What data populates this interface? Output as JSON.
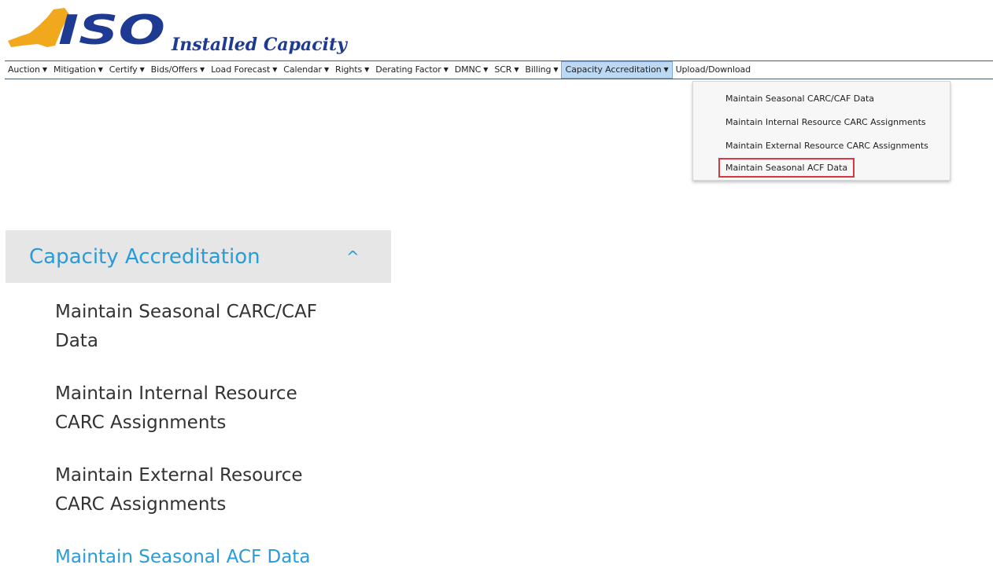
{
  "header": {
    "logo_text": "ISO",
    "app_title": "Installed Capacity"
  },
  "menu": {
    "items": [
      {
        "label": "Auction",
        "caret": "▼"
      },
      {
        "label": "Mitigation",
        "caret": "▼"
      },
      {
        "label": "Certify",
        "caret": "▼"
      },
      {
        "label": "Bids/Offers",
        "caret": "▼"
      },
      {
        "label": "Load Forecast",
        "caret": "▼"
      },
      {
        "label": "Calendar",
        "caret": "▼"
      },
      {
        "label": "Rights",
        "caret": "▼"
      },
      {
        "label": "Derating Factor",
        "caret": "▼"
      },
      {
        "label": "DMNC",
        "caret": "▼"
      },
      {
        "label": "SCR",
        "caret": "▼"
      },
      {
        "label": "Billing",
        "caret": "▼"
      },
      {
        "label": "Capacity Accreditation",
        "caret": "▼"
      },
      {
        "label": "Upload/Download",
        "caret": ""
      }
    ],
    "active_index": 11
  },
  "dropdown": {
    "items": [
      "Maintain Seasonal CARC/CAF Data",
      "Maintain Internal Resource CARC Assignments",
      "Maintain External Resource CARC Assignments",
      "Maintain Seasonal ACF Data"
    ],
    "highlight_color": "#d9393e"
  },
  "side_nav": {
    "title": "Capacity Accreditation",
    "chevron": "^",
    "links": [
      [
        "Maintain Seasonal CARC/CAF",
        "Data"
      ],
      [
        "Maintain Internal Resource",
        "CARC Assignments"
      ],
      [
        "Maintain External Resource",
        "CARC Assignments"
      ],
      [
        "Maintain Seasonal ACF Data"
      ]
    ]
  },
  "colors": {
    "accent": "#2a9bd8",
    "logo_blue": "#1f3a93",
    "logo_gold": "#f2a81d",
    "menu_active_bg": "#bcd8f3"
  }
}
